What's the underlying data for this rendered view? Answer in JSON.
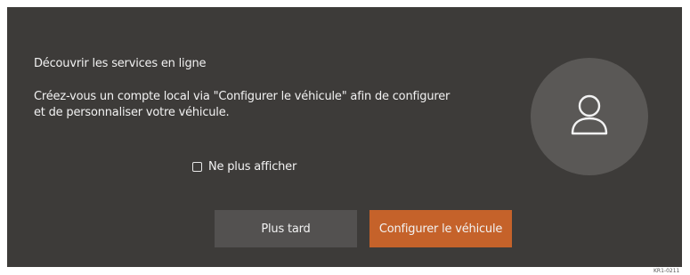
{
  "dialog": {
    "title": "Découvrir les services en ligne",
    "message": "Créez-vous un compte local via \"Configurer le véhicule\" afin de configurer et de personnaliser votre véhicule.",
    "checkbox_label": "Ne plus afficher",
    "checkbox_checked": false,
    "later_label": "Plus tard",
    "configure_label": "Configurer le véhicule",
    "avatar_icon": "user-icon"
  },
  "colors": {
    "background": "#3d3b39",
    "avatar_circle": "#5a5856",
    "secondary_button": "#535150",
    "primary_button": "#c5622a"
  },
  "figure_code": "KR1-0211"
}
